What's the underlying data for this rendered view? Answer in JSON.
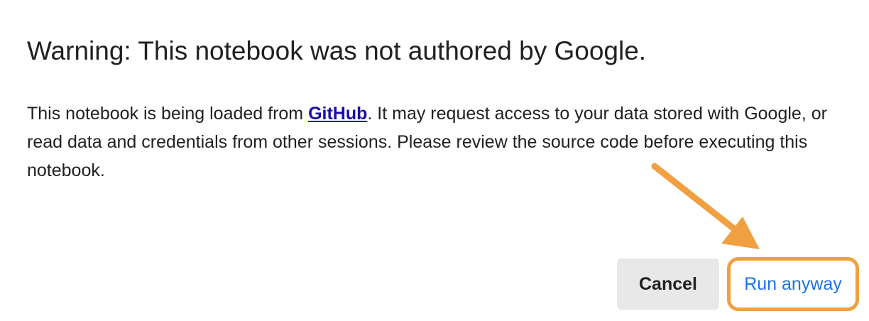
{
  "dialog": {
    "title": "Warning: This notebook was not authored by Google.",
    "body_before_link": "This notebook is being loaded from ",
    "link_text": "GitHub",
    "body_after_link": ". It may request access to your data stored with Google, or read data and credentials from other sessions. Please review the source code before executing this notebook."
  },
  "buttons": {
    "cancel_label": "Cancel",
    "run_label": "Run anyway"
  },
  "colors": {
    "link": "#1a0dab",
    "primary_action": "#1a73e8",
    "highlight": "#f0a040",
    "secondary_button_bg": "#e8e8e8"
  },
  "annotation": {
    "icon": "arrow-icon"
  }
}
